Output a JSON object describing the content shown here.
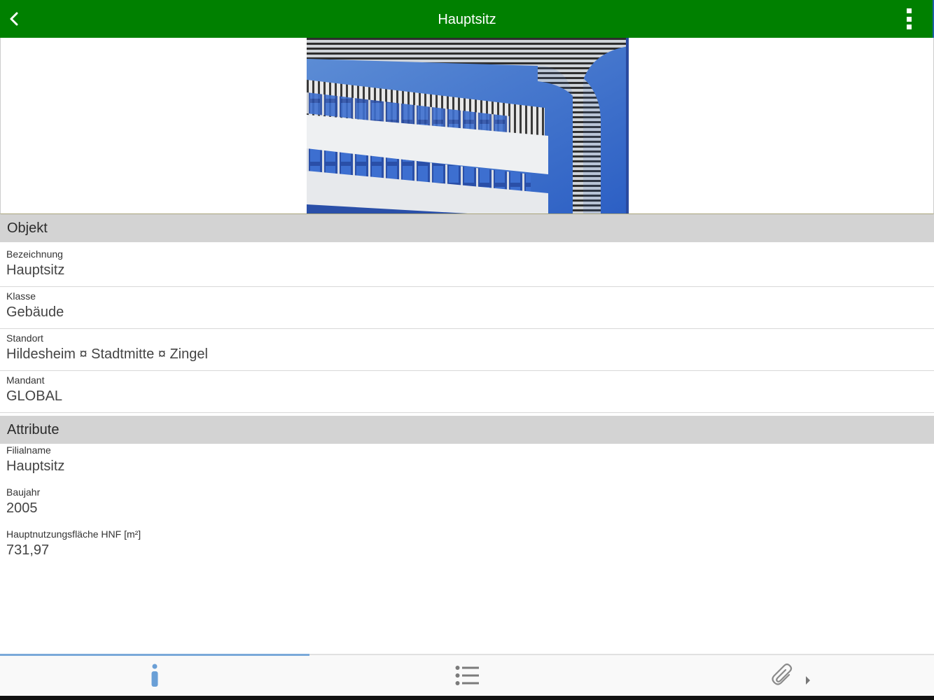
{
  "app_bar": {
    "title": "Hauptsitz",
    "back_icon": "chevron-left-icon",
    "menu_icon": "more-vertical-icon",
    "background_color": "#008000"
  },
  "image": {
    "description_icon": "building-photo"
  },
  "sections": {
    "objekt": {
      "title": "Objekt",
      "fields": [
        {
          "label": "Bezeichnung",
          "value": "Hauptsitz"
        },
        {
          "label": "Klasse",
          "value": "Gebäude"
        },
        {
          "label": "Standort",
          "value": "Hildesheim ¤ Stadtmitte ¤ Zingel"
        },
        {
          "label": "Mandant",
          "value": "GLOBAL"
        }
      ]
    },
    "attribute": {
      "title": "Attribute",
      "fields": [
        {
          "label": "Filialname",
          "value": "Hauptsitz"
        },
        {
          "label": "Baujahr",
          "value": "2005"
        },
        {
          "label": "Hauptnutzungsfläche HNF [m²]",
          "value": "731,97"
        }
      ]
    }
  },
  "tab_bar": {
    "tabs": [
      {
        "icon": "info-icon",
        "active": true
      },
      {
        "icon": "list-icon",
        "active": false
      },
      {
        "icon": "paperclip-icon",
        "active": false
      }
    ],
    "accent_color": "#7aa9d9"
  }
}
